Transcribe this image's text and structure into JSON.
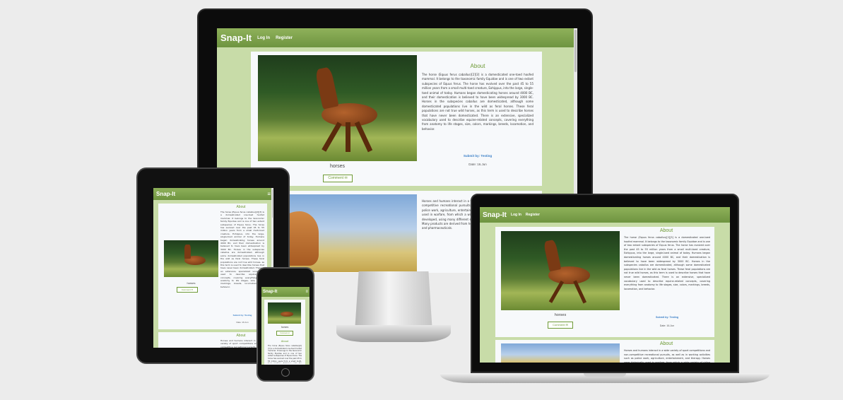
{
  "site": {
    "brand": "Snap-It",
    "nav_login": "Log In",
    "nav_register": "Register",
    "menu_glyph": "≡"
  },
  "post1": {
    "title": "About",
    "body": "The horse (Equus ferus caballus)[2][3] is a domesticated one-toed hoofed mammal. It belongs to the taxonomic family Equidae and is one of two extant subspecies of Equus ferus. The horse has evolved over the past 45 to 55 million years from a small multi-toed creature, Eohippus, into the large, single-toed animal of today. Humans began domesticating horses around 4000 BC, and their domestication is believed to have been widespread by 3000 BC. Horses in the subspecies caballus are domesticated, although some domesticated populations live in the wild as feral horses. These feral populations are not true wild horses, as this term is used to describe horses that have never been domesticated. There is an extensive, specialized vocabulary used to describe equine-related concepts, covering everything from anatomy to life stages, size, colors, markings, breeds, locomotion, and behavior.",
    "caption": "horses",
    "comment_label": "Comment",
    "comment_icon": "✉",
    "submitted": "Submit by: Testing",
    "date": "Date: 16.Jun"
  },
  "post2": {
    "title": "About",
    "body": "Horses and humans interact in a wide variety of sport competitions and non-competitive recreational pursuits, as well as in working activities such as police work, agriculture, entertainment, and therapy. Horses were historically used in warfare, from which a wide variety of riding and driving techniques developed, using many different styles of equipment and methods of control. Many products are derived from horses, including meat, milk, hide, hair, bone, and pharmaceuticals."
  },
  "devices": [
    "desktop-monitor",
    "tablet",
    "phone",
    "laptop"
  ]
}
